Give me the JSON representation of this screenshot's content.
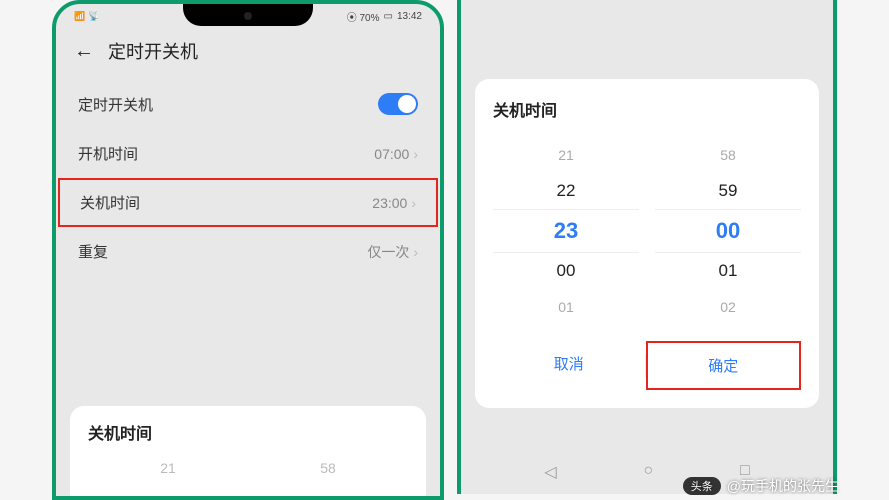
{
  "statusBar": {
    "battery": "70%",
    "time": "13:42"
  },
  "header": {
    "title": "定时开关机"
  },
  "rows": {
    "toggleLabel": "定时开关机",
    "onTimeLabel": "开机时间",
    "onTimeValue": "07:00",
    "offTimeLabel": "关机时间",
    "offTimeValue": "23:00",
    "repeatLabel": "重复",
    "repeatValue": "仅一次"
  },
  "picker": {
    "title": "关机时间",
    "hoursFaded": "21",
    "minutesFaded": "58",
    "hours": [
      "21",
      "22",
      "23",
      "00",
      "01"
    ],
    "minutes": [
      "58",
      "59",
      "00",
      "01",
      "02"
    ]
  },
  "actions": {
    "cancel": "取消",
    "confirm": "确定"
  },
  "watermark": {
    "badge": "头条",
    "text": "@玩手机的张先生"
  }
}
